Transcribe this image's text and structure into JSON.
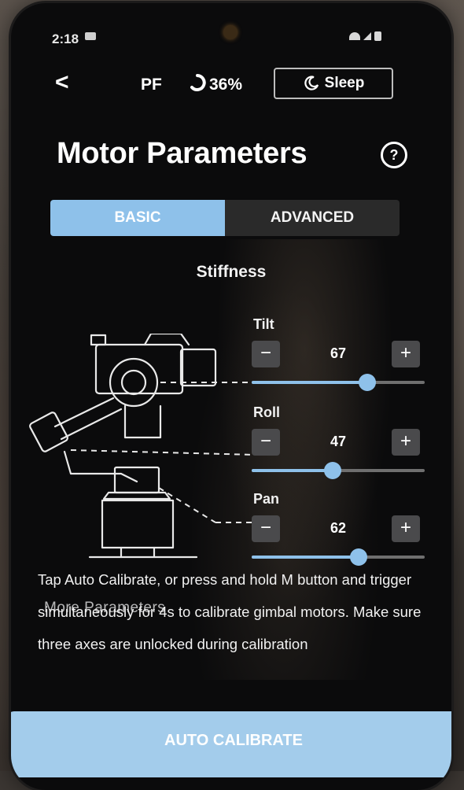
{
  "status_bar": {
    "time": "2:18"
  },
  "header": {
    "back_label": "<",
    "mode": "PF",
    "battery": "36%",
    "sleep_label": "Sleep"
  },
  "page": {
    "title": "Motor Parameters",
    "help_icon": "?"
  },
  "tabs": [
    {
      "label": "BASIC",
      "active": true
    },
    {
      "label": "ADVANCED",
      "active": false
    }
  ],
  "section": {
    "title": "Stiffness"
  },
  "axes": [
    {
      "label": "Tilt",
      "value": "67",
      "level": 0.67
    },
    {
      "label": "Roll",
      "value": "47",
      "level": 0.47
    },
    {
      "label": "Pan",
      "value": "62",
      "level": 0.62
    }
  ],
  "stepper": {
    "minus": "−",
    "plus": "+"
  },
  "instructions": "Tap Auto Calibrate, or press and hold M button and trigger simultaneously for 4s to calibrate gimbal motors. Make sure three axes are unlocked during calibration",
  "more_parameters": "More Parameters",
  "auto_calibrate_label": "AUTO CALIBRATE",
  "colors": {
    "accent": "#8ec1ea",
    "button": "#a3cceb",
    "background": "#0b0b0c"
  }
}
